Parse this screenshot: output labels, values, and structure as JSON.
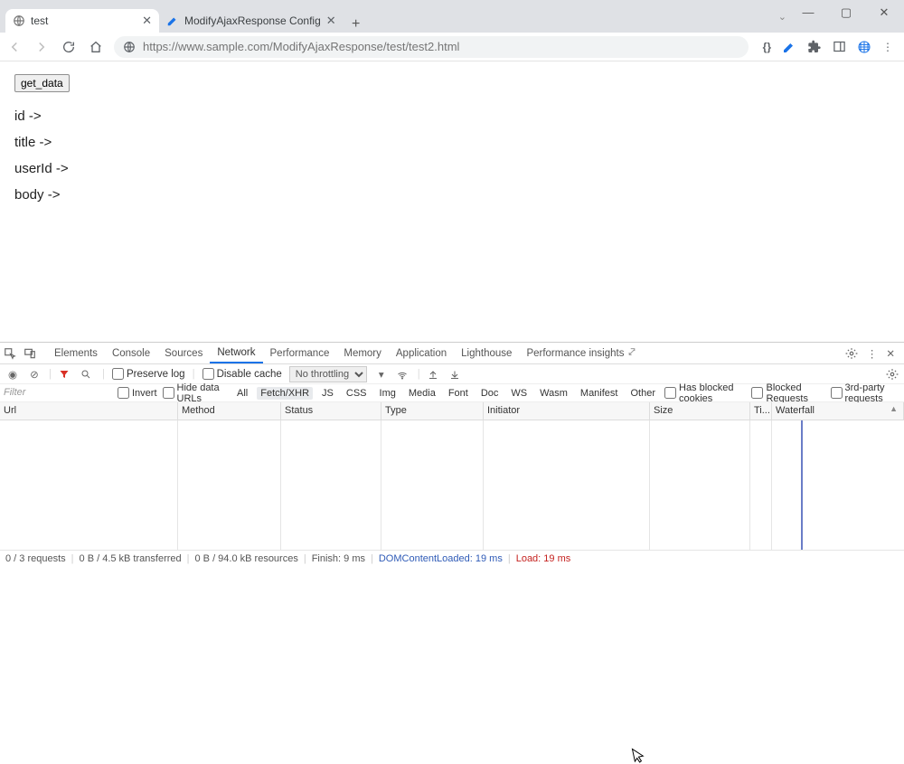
{
  "window": {
    "controls": {
      "minimize": "—",
      "maximize": "▢",
      "close": "✕"
    }
  },
  "tabs": [
    {
      "label": "test",
      "active": true
    },
    {
      "label": "ModifyAjaxResponse Config",
      "active": false
    }
  ],
  "toolbar": {
    "url": "https://www.sample.com/ModifyAjaxResponse/test/test2.html"
  },
  "page": {
    "button": "get_data",
    "lines": {
      "id": "id ->",
      "title": "title ->",
      "userId": "userId ->",
      "body": "body ->"
    }
  },
  "devtools": {
    "tabs": [
      "Elements",
      "Console",
      "Sources",
      "Network",
      "Performance",
      "Memory",
      "Application",
      "Lighthouse",
      "Performance insights"
    ],
    "active_tab": "Network",
    "nt_bar": {
      "preserve_log": "Preserve log",
      "disable_cache": "Disable cache",
      "throttling": "No throttling"
    },
    "filter": {
      "placeholder": "Filter",
      "invert": "Invert",
      "hide_data": "Hide data URLs",
      "types": [
        "All",
        "Fetch/XHR",
        "JS",
        "CSS",
        "Img",
        "Media",
        "Font",
        "Doc",
        "WS",
        "Wasm",
        "Manifest",
        "Other"
      ],
      "active_type": "Fetch/XHR",
      "blocked_cookies": "Has blocked cookies",
      "blocked_req": "Blocked Requests",
      "third_party": "3rd-party requests"
    },
    "columns": {
      "url": "Url",
      "method": "Method",
      "status": "Status",
      "type": "Type",
      "initiator": "Initiator",
      "size": "Size",
      "time": "Ti...",
      "waterfall": "Waterfall"
    },
    "status_bar": {
      "requests": "0 / 3 requests",
      "transferred": "0 B / 4.5 kB transferred",
      "resources": "0 B / 94.0 kB resources",
      "finish": "Finish: 9 ms",
      "dcl_label": "DOMContentLoaded: ",
      "dcl_val": "19 ms",
      "load_label": "Load: ",
      "load_val": "19 ms"
    }
  }
}
